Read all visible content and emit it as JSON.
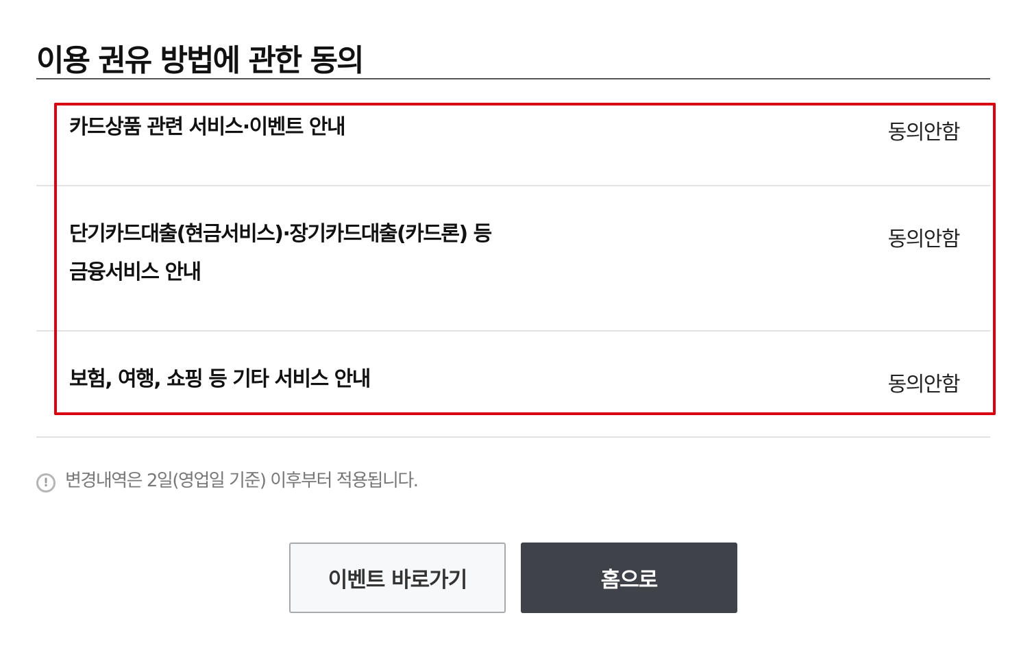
{
  "page": {
    "title": "이용 권유 방법에 관한 동의"
  },
  "consent_items": [
    {
      "label_lines": [
        "카드상품 관련 서비스·이벤트 안내"
      ],
      "status": "동의안함"
    },
    {
      "label_lines": [
        "단기카드대출(현금서비스)·장기카드대출(카드론) 등",
        "금융서비스 안내"
      ],
      "status": "동의안함"
    },
    {
      "label_lines": [
        "보험, 여행, 쇼핑 등 기타 서비스 안내"
      ],
      "status": "동의안함"
    }
  ],
  "notice": {
    "icon": "exclamation-circle-icon",
    "text": "변경내역은 2일(영업일 기준) 이후부터 적용됩니다."
  },
  "buttons": {
    "event_label": "이벤트 바로가기",
    "home_label": "홈으로"
  },
  "colors": {
    "highlight": "#d90012",
    "primary_button": "#3f4249"
  }
}
